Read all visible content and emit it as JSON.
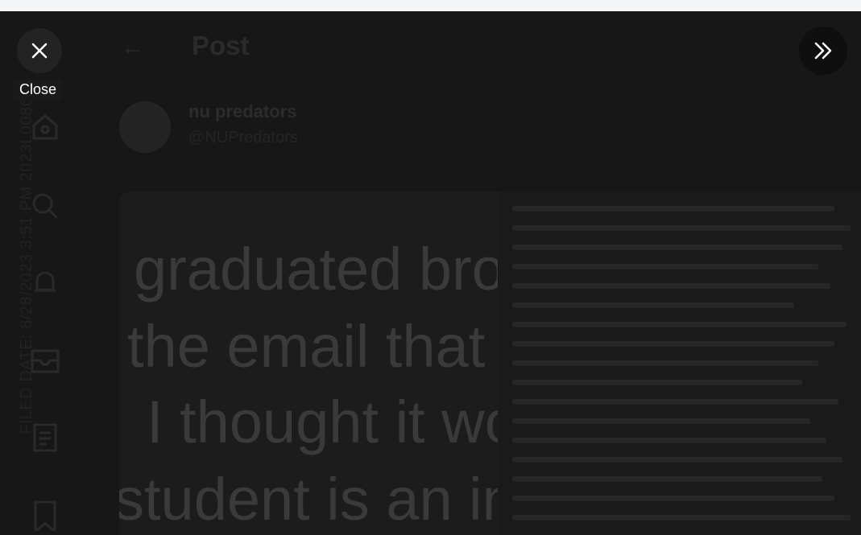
{
  "header": {
    "back_icon": "arrow-left-icon",
    "title": "Post"
  },
  "account": {
    "name": "nu predators",
    "handle": "@NUPredators"
  },
  "post_text_lines": [
    "graduated bro",
    "the email that",
    "I thought it wo",
    "student is an in"
  ],
  "watermark": "FILED DATE: 8/28/2023 3:51 PM  2023L008681",
  "overlay": {
    "close_icon": "close-icon",
    "close_tooltip": "Close",
    "next_icon": "chevrons-right-icon"
  },
  "sidebar_icons": [
    "home-icon",
    "search-icon",
    "notifications-icon",
    "messages-icon",
    "lists-icon",
    "bookmark-icon"
  ],
  "colors": {
    "background": "#171717",
    "tooltip_bg": "#1a1a1a",
    "tooltip_text": "#ffffff",
    "page_bg": "#f4f5f7"
  }
}
